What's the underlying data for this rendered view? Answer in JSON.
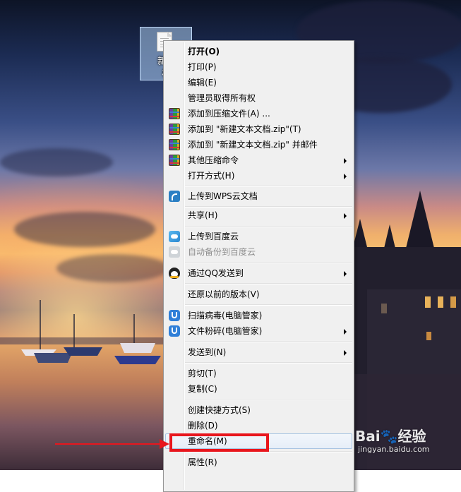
{
  "desktop": {
    "file": {
      "label_line1": "新建",
      "label_line2": "档"
    }
  },
  "menu": {
    "items": [
      {
        "label": "打开(O)",
        "icon": "",
        "submenu": false,
        "bold": true
      },
      {
        "label": "打印(P)",
        "icon": "",
        "submenu": false
      },
      {
        "label": "编辑(E)",
        "icon": "",
        "submenu": false
      },
      {
        "label": "管理员取得所有权",
        "icon": "",
        "submenu": false
      },
      {
        "label": "添加到压缩文件(A) ...",
        "icon": "winrar-icon",
        "submenu": false
      },
      {
        "label": "添加到 \"新建文本文档.zip\"(T)",
        "icon": "winrar-icon",
        "submenu": false
      },
      {
        "label": "添加到 \"新建文本文档.zip\" 并邮件",
        "icon": "winrar-icon",
        "submenu": false
      },
      {
        "label": "其他压缩命令",
        "icon": "winrar-icon",
        "submenu": true
      },
      {
        "label": "打开方式(H)",
        "icon": "",
        "submenu": true
      },
      {
        "label": "上传到WPS云文档",
        "icon": "wps-cloud-icon",
        "submenu": false
      },
      {
        "label": "共享(H)",
        "icon": "",
        "submenu": true
      },
      {
        "label": "上传到百度云",
        "icon": "baidu-cloud-icon",
        "submenu": false
      },
      {
        "label": "自动备份到百度云",
        "icon": "baidu-cloud-icon",
        "submenu": false,
        "disabled": true
      },
      {
        "label": "通过QQ发送到",
        "icon": "qq-icon",
        "submenu": true
      },
      {
        "label": "还原以前的版本(V)",
        "icon": "",
        "submenu": false
      },
      {
        "label": "扫描病毒(电脑管家)",
        "icon": "pc-manager-icon",
        "submenu": false
      },
      {
        "label": "文件粉碎(电脑管家)",
        "icon": "pc-manager-icon",
        "submenu": true
      },
      {
        "label": "发送到(N)",
        "icon": "",
        "submenu": true
      },
      {
        "label": "剪切(T)",
        "icon": "",
        "submenu": false
      },
      {
        "label": "复制(C)",
        "icon": "",
        "submenu": false
      },
      {
        "label": "创建快捷方式(S)",
        "icon": "",
        "submenu": false
      },
      {
        "label": "删除(D)",
        "icon": "",
        "submenu": false
      },
      {
        "label": "重命名(M)",
        "icon": "",
        "submenu": false,
        "hovered": true
      },
      {
        "label": "属性(R)",
        "icon": "",
        "submenu": false
      }
    ]
  },
  "watermark": {
    "brand": "Bai🐾经验",
    "url": "jingyan.baidu.com"
  },
  "colors": {
    "annotation": "#e8161d",
    "menu_bg": "#f0f0f0",
    "hover_border": "#a8c4e2"
  }
}
